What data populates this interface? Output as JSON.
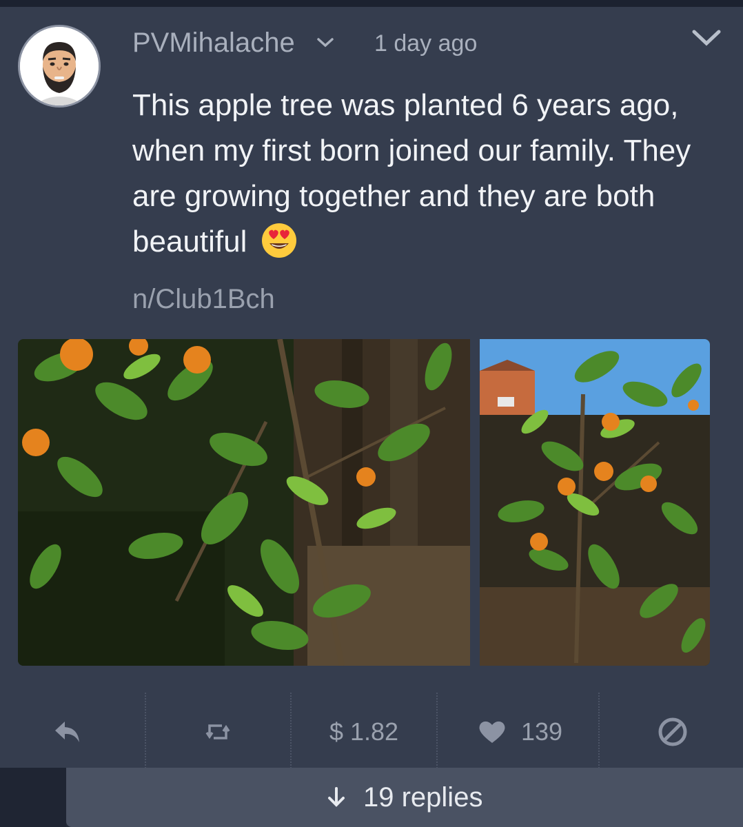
{
  "post": {
    "username": "PVMihalache",
    "timestamp": "1 day ago",
    "text": "This apple tree was planted 6 years ago, when my first born joined our family. They are growing together and they are both beautiful",
    "emoji": "smiling-face-with-heart-eyes",
    "community": "n/Club1Bch"
  },
  "actions": {
    "earnings": "$ 1.82",
    "likes": "139"
  },
  "replies": {
    "label": "19 replies"
  },
  "icons": [
    "avatar",
    "chevron-down-icon",
    "reply-icon",
    "repost-icon",
    "heart-icon",
    "block-icon",
    "arrow-down-icon"
  ],
  "colors": {
    "background": "#232a38",
    "card": "#353d4e",
    "muted_text": "#a9b0bd",
    "body_text": "#f1f3f6",
    "replies_bar": "#4a5263"
  }
}
